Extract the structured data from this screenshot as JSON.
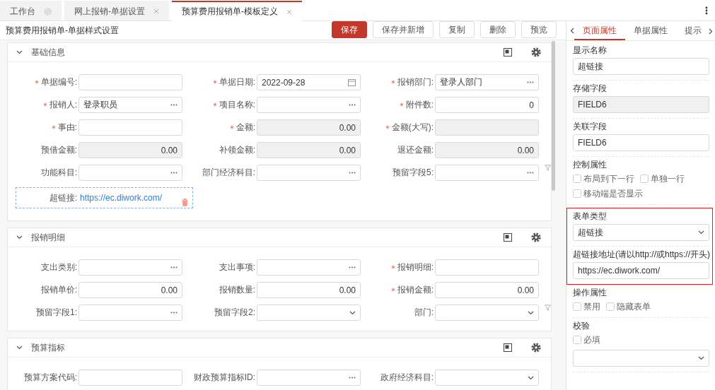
{
  "tabs": [
    {
      "label": "工作台",
      "kind": "pinned",
      "selected": false
    },
    {
      "label": "网上报销-单据设置",
      "kind": "closable",
      "selected": false
    },
    {
      "label": "预算费用报销单-模板定义",
      "kind": "closable",
      "selected": true
    }
  ],
  "page_title": "预算费用报销单-单据样式设置",
  "buttons": [
    {
      "label": "保存",
      "primary": true
    },
    {
      "label": "保存并新增",
      "primary": false
    },
    {
      "label": "复制",
      "primary": false
    },
    {
      "label": "删除",
      "primary": false
    },
    {
      "label": "预览",
      "primary": false
    }
  ],
  "sections": [
    {
      "title": "基础信息",
      "expanded": true,
      "rows": [
        {
          "filter": false,
          "fields": [
            {
              "label": "单据编号:",
              "required": true,
              "kind": "text"
            },
            {
              "label": "单据日期:",
              "required": true,
              "kind": "date",
              "value": "2022-09-28"
            },
            {
              "label": "报销部门:",
              "required": true,
              "kind": "lookup",
              "value": "登录人部门"
            }
          ]
        },
        {
          "filter": false,
          "fields": [
            {
              "label": "报销人:",
              "required": true,
              "kind": "lookup",
              "value": "登录职员"
            },
            {
              "label": "项目名称:",
              "required": true,
              "kind": "lookup"
            },
            {
              "label": "附件数:",
              "required": true,
              "kind": "number",
              "value": "0"
            }
          ]
        },
        {
          "filter": false,
          "fields": [
            {
              "label": "事由:",
              "required": true,
              "kind": "text"
            },
            {
              "label": "金额:",
              "required": true,
              "kind": "readonly",
              "value": "0.00"
            },
            {
              "label": "金额(大写):",
              "required": true,
              "kind": "readonly"
            }
          ]
        },
        {
          "filter": false,
          "fields": [
            {
              "label": "预借金额:",
              "required": false,
              "kind": "readonly",
              "value": "0.00"
            },
            {
              "label": "补领金额:",
              "required": false,
              "kind": "readonly",
              "value": "0.00"
            },
            {
              "label": "退还金额:",
              "required": false,
              "kind": "readonly",
              "value": "0.00"
            }
          ]
        },
        {
          "filter": true,
          "fields": [
            {
              "label": "功能科目:",
              "required": false,
              "kind": "lookup"
            },
            {
              "label": "部门经济科目:",
              "required": false,
              "kind": "lookup"
            },
            {
              "label": "预留字段5:",
              "required": false,
              "kind": "lookup"
            }
          ]
        },
        {
          "filter": false,
          "fields": [
            {
              "label": "超链接:",
              "required": false,
              "kind": "link",
              "value": "https://ec.diwork.com/",
              "selected": true
            }
          ]
        }
      ]
    },
    {
      "title": "报销明细",
      "expanded": true,
      "rows": [
        {
          "filter": false,
          "fields": [
            {
              "label": "支出类别:",
              "required": false,
              "kind": "lookup"
            },
            {
              "label": "支出事项:",
              "required": false,
              "kind": "lookup"
            },
            {
              "label": "报销明细:",
              "required": true,
              "kind": "text"
            }
          ]
        },
        {
          "filter": false,
          "fields": [
            {
              "label": "报销单价:",
              "required": false,
              "kind": "number",
              "value": "0.00"
            },
            {
              "label": "报销数量:",
              "required": false,
              "kind": "number",
              "value": "0.00"
            },
            {
              "label": "报销金额:",
              "required": true,
              "kind": "number",
              "value": "0.00"
            }
          ]
        },
        {
          "filter": true,
          "fields": [
            {
              "label": "预留字段1:",
              "required": false,
              "kind": "lookup"
            },
            {
              "label": "预留字段2:",
              "required": false,
              "kind": "select"
            },
            {
              "label": "部门:",
              "required": false,
              "kind": "select"
            }
          ]
        }
      ]
    },
    {
      "title": "预算指标",
      "expanded": true,
      "rows": [
        {
          "filter": false,
          "fields": [
            {
              "label": "预算方案代码:",
              "required": false,
              "kind": "text"
            },
            {
              "label": "财政预算指标ID:",
              "required": false,
              "kind": "lookup"
            },
            {
              "label": "政府经济科目:",
              "required": false,
              "kind": "select"
            }
          ]
        }
      ]
    }
  ],
  "panel_tabs": [
    {
      "label": "页面属性",
      "selected": true
    },
    {
      "label": "单据属性",
      "selected": false
    },
    {
      "label": "提示",
      "selected": false
    }
  ],
  "properties": [
    {
      "kind": "field",
      "label": "显示名称",
      "value": "超链接"
    },
    {
      "kind": "readonly",
      "label": "存储字段",
      "value": "FIELD6"
    },
    {
      "kind": "field",
      "label": "关联字段",
      "value": "FIELD6"
    },
    {
      "kind": "checks",
      "label": "控制属性",
      "dropdown": false,
      "lines": [
        [
          {
            "label": "布局到下一行",
            "checked": false
          },
          {
            "label": "单独一行",
            "checked": false
          }
        ],
        [
          {
            "label": "移动端是否显示",
            "checked": false
          }
        ]
      ]
    },
    {
      "kind": "frame",
      "groups": [
        {
          "kind": "select",
          "label": "表单类型",
          "value": "超链接"
        },
        {
          "kind": "field",
          "label": "超链接地址(请以http://或https://开头)",
          "value": "https://ec.diwork.com/"
        }
      ]
    },
    {
      "kind": "checks",
      "label": "操作属性",
      "dropdown": false,
      "lines": [
        [
          {
            "label": "禁用",
            "checked": false
          },
          {
            "label": "隐藏表单",
            "checked": false
          }
        ]
      ]
    },
    {
      "kind": "checks",
      "label": "校验",
      "dropdown": true,
      "lines": [
        [
          {
            "label": "必填",
            "checked": false
          }
        ]
      ]
    }
  ]
}
